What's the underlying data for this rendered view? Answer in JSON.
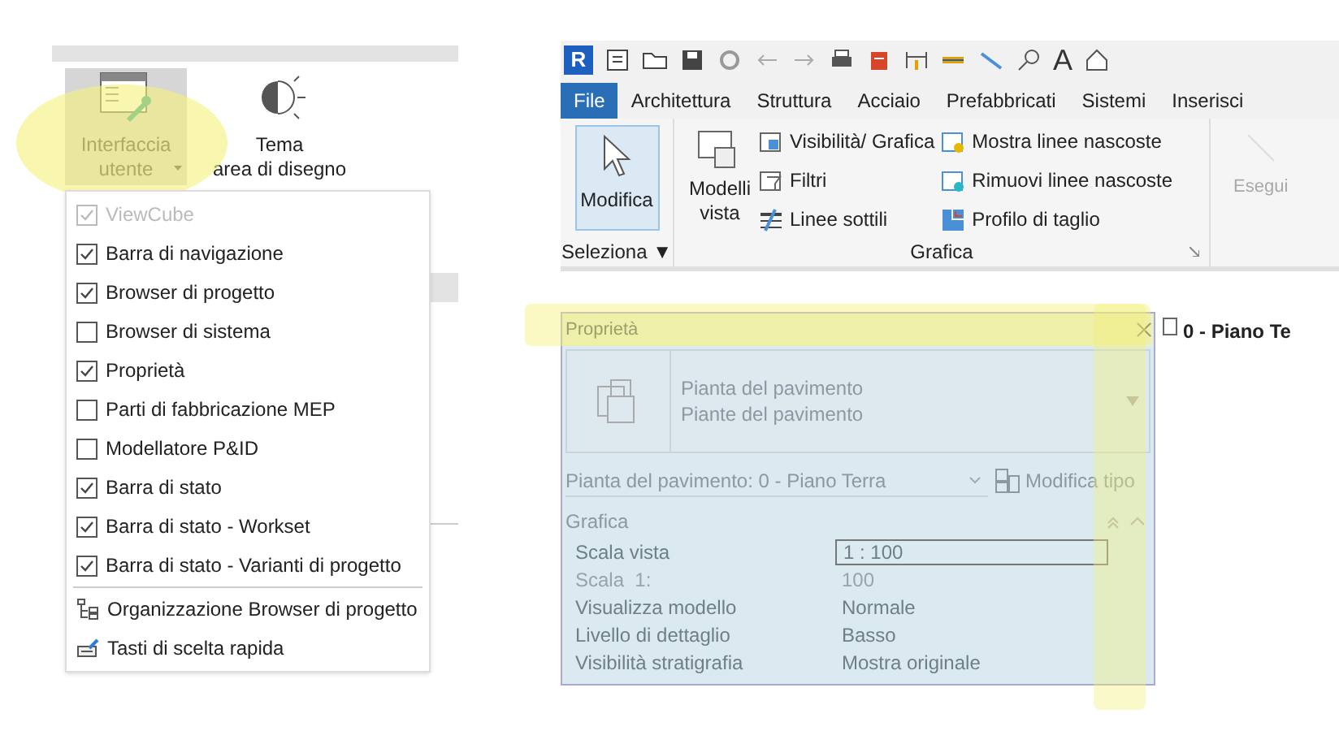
{
  "left": {
    "ribbon_buttons": [
      {
        "lines": [
          "Interfaccia",
          "utente"
        ],
        "selected": true,
        "dropdown": true,
        "kind": "ui"
      },
      {
        "lines": [
          "Tema",
          "area di disegno"
        ],
        "selected": false,
        "dropdown": false,
        "kind": "theme"
      }
    ],
    "menu": [
      {
        "kind": "check",
        "label": "ViewCube",
        "checked": true,
        "disabled": true
      },
      {
        "kind": "check",
        "label": "Barra di navigazione",
        "checked": true,
        "disabled": false
      },
      {
        "kind": "check",
        "label": "Browser di progetto",
        "checked": true,
        "disabled": false
      },
      {
        "kind": "check",
        "label": "Browser di sistema",
        "checked": false,
        "disabled": false
      },
      {
        "kind": "check",
        "label": "Proprietà",
        "checked": true,
        "disabled": false
      },
      {
        "kind": "check",
        "label": "Parti di fabbricazione MEP",
        "checked": false,
        "disabled": false
      },
      {
        "kind": "check",
        "label": "Modellatore P&ID",
        "checked": false,
        "disabled": false
      },
      {
        "kind": "check",
        "label": "Barra di stato",
        "checked": true,
        "disabled": false
      },
      {
        "kind": "check",
        "label": "Barra di stato - Workset",
        "checked": true,
        "disabled": false
      },
      {
        "kind": "check",
        "label": "Barra di stato - Varianti di progetto",
        "checked": true,
        "disabled": false
      },
      {
        "kind": "tree",
        "label": "Organizzazione Browser di progetto"
      },
      {
        "kind": "keys",
        "label": "Tasti di scelta rapida"
      }
    ]
  },
  "right": {
    "app_letter": "R",
    "text_tool_glyph": "A",
    "tabs": [
      {
        "label": "File",
        "selected": true
      },
      {
        "label": "Architettura",
        "selected": false
      },
      {
        "label": "Struttura",
        "selected": false
      },
      {
        "label": "Acciaio",
        "selected": false
      },
      {
        "label": "Prefabbricati",
        "selected": false
      },
      {
        "label": "Sistemi",
        "selected": false
      },
      {
        "label": "Inserisci",
        "selected": false
      }
    ],
    "select_group": {
      "button": "Modifica",
      "selected": true,
      "label": "Seleziona ▼"
    },
    "graphics_group": {
      "big_button": [
        "Modelli",
        "vista"
      ],
      "label": "Grafica",
      "col1": [
        {
          "kind": "vis",
          "label": "Visibilità/ Grafica"
        },
        {
          "kind": "filter",
          "label": "Filtri"
        },
        {
          "kind": "thin",
          "label": "Linee sottili"
        }
      ],
      "col2": [
        {
          "kind": "show",
          "label": "Mostra linee nascoste"
        },
        {
          "kind": "remove",
          "label": "Rimuovi linee nascoste"
        },
        {
          "kind": "cut",
          "label": "Profilo di taglio"
        }
      ]
    },
    "faded_button": "Esegui",
    "view_tab": "0 - Piano Te",
    "properties": {
      "title": "Proprietà",
      "type_lines": [
        "Pianta del pavimento",
        "Piante del pavimento"
      ],
      "instance": "Pianta del pavimento: 0 - Piano Terra",
      "edit_type": "Modifica tipo",
      "section": "Grafica",
      "rows": [
        {
          "name": "Scala vista",
          "value": "1 : 100",
          "kind": "field",
          "disabled": false
        },
        {
          "name": "Scala  1:",
          "value": "100",
          "kind": "text",
          "disabled": true
        },
        {
          "name": "Visualizza modello",
          "value": "Normale",
          "kind": "text",
          "disabled": false
        },
        {
          "name": "Livello di dettaglio",
          "value": "Basso",
          "kind": "text",
          "disabled": false
        },
        {
          "name": "Visibilità stratigrafia",
          "value": "Mostra originale",
          "kind": "text",
          "disabled": false
        }
      ]
    }
  }
}
